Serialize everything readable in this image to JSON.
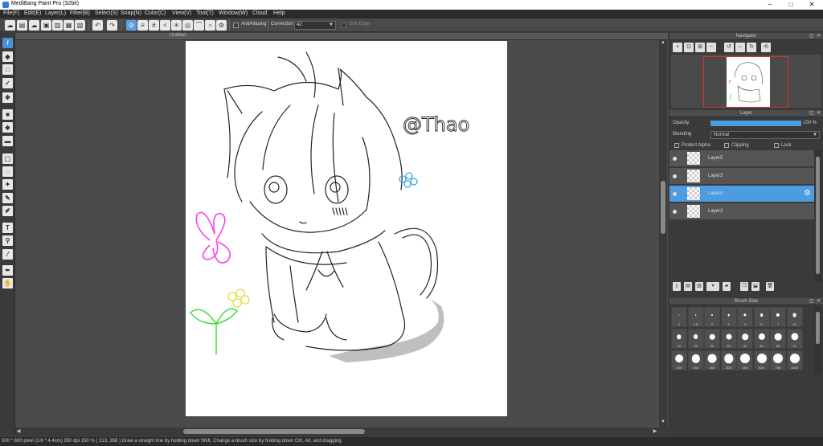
{
  "window": {
    "title": "MediBang Paint Pro (32bit)",
    "minimize": "–",
    "maximize": "□",
    "close": "✕"
  },
  "menu": [
    "File(F)",
    "Edit(E)",
    "Layer(L)",
    "Filter(B)",
    "Select(S)",
    "Snap(N)",
    "Color(C)",
    "View(V)",
    "Tool(T)",
    "Window(W)",
    "Cloud",
    "Help"
  ],
  "toolbar": {
    "antialiasing_label": "AntiAliasing",
    "correction_label": "Correction",
    "correction_value": "42",
    "soft_edge_label": "Soft Edge"
  },
  "canvas": {
    "doc_title": "Untitled",
    "drawing_signature": "@Thao",
    "line_color": "#222222",
    "butterfly_color": "#ff3ee6",
    "sprout_color": "#33dd33",
    "flower_color": "#dddd33",
    "blue_flower_color": "#3aa8e0",
    "vertical_scroll_fraction": 0.42,
    "horizontal_scroll_fraction": 0.36
  },
  "statusbar": {
    "text": "500 * 600 pixel   (3.6 * 4.4cm)   350 dpi   150 %   ( 213, 358 )   Draw a straight line by holding down Shift, Change a brush size by holding down Ctrl, Alt, and dragging"
  },
  "navigator": {
    "title": "Navigator"
  },
  "layer_panel": {
    "title": "Layer",
    "opacity_label": "Opacity",
    "opacity_value": "100 %",
    "opacity_fraction": 1.0,
    "blending_label": "Blending",
    "blending_value": "Normal",
    "protect_alpha_label": "Protect Alpha",
    "clipping_label": "Clipping",
    "lock_label": "Lock",
    "layers": [
      {
        "name": "Layer5",
        "selected": false
      },
      {
        "name": "Layer3",
        "selected": false
      },
      {
        "name": "Layer4",
        "selected": true
      },
      {
        "name": "Layer2",
        "selected": false
      }
    ]
  },
  "brush_panel": {
    "title": "Brush Size",
    "sizes": [
      "1",
      "1.5",
      "2",
      "3",
      "4",
      "5",
      "7",
      "10",
      "12",
      "15",
      "20",
      "25",
      "30",
      "40",
      "50",
      "70",
      "100",
      "150",
      "200",
      "300",
      "400",
      "600",
      "700",
      "1000"
    ]
  },
  "colors": {
    "accent": "#4d9be0",
    "panel_bg": "#3a3a3a",
    "canvas_bg": "#4b4b4b"
  }
}
